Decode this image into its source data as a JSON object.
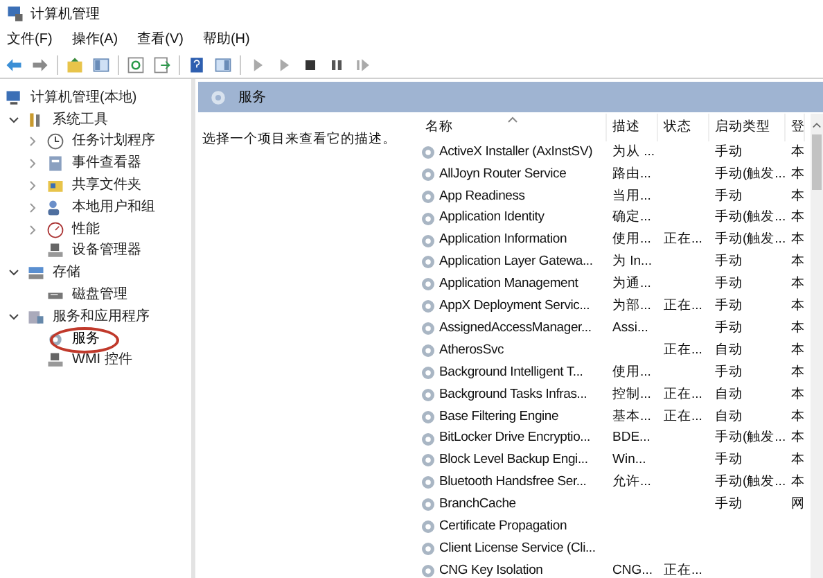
{
  "window": {
    "title": "计算机管理"
  },
  "menu": [
    "文件(F)",
    "操作(A)",
    "查看(V)",
    "帮助(H)"
  ],
  "tree": [
    {
      "label": "计算机管理(本地)",
      "kind": "computer",
      "selected": false,
      "children": [
        {
          "label": "系统工具",
          "kind": "tools",
          "expanded": true,
          "selected": false,
          "children": [
            {
              "label": "任务计划程序",
              "kind": "clock",
              "expanded": false,
              "selected": false
            },
            {
              "label": "事件查看器",
              "kind": "log",
              "expanded": false,
              "selected": false
            },
            {
              "label": "共享文件夹",
              "kind": "folder",
              "expanded": false,
              "selected": false
            },
            {
              "label": "本地用户和组",
              "kind": "users",
              "expanded": false,
              "selected": false
            },
            {
              "label": "性能",
              "kind": "gauge",
              "expanded": false,
              "selected": false
            },
            {
              "label": "设备管理器",
              "kind": "device",
              "selected": false
            }
          ]
        },
        {
          "label": "存储",
          "kind": "storage",
          "expanded": true,
          "selected": false,
          "children": [
            {
              "label": "磁盘管理",
              "kind": "disk",
              "selected": false
            }
          ]
        },
        {
          "label": "服务和应用程序",
          "kind": "apps",
          "expanded": true,
          "selected": false,
          "children": [
            {
              "label": "服务",
              "kind": "gear",
              "selected": true
            },
            {
              "label": "WMI 控件",
              "kind": "device",
              "selected": false
            }
          ]
        }
      ]
    }
  ],
  "pane": {
    "title": "服务",
    "hint": "选择一个项目来查看它的描述。"
  },
  "columns": [
    {
      "label": "名称",
      "sorted": true
    },
    {
      "label": "描述",
      "sorted": false
    },
    {
      "label": "状态",
      "sorted": false
    },
    {
      "label": "启动类型",
      "sorted": false
    },
    {
      "label": "登",
      "sorted": false
    }
  ],
  "rows": [
    {
      "name": "ActiveX Installer (AxInstSV)",
      "description": "为从 ...",
      "startup": "手动",
      "logon": "本"
    },
    {
      "name": "AllJoyn Router Service",
      "description": "路由...",
      "startup": "手动(触发...",
      "logon": "本"
    },
    {
      "name": "App Readiness",
      "description": "当用...",
      "startup": "手动",
      "logon": "本"
    },
    {
      "name": "Application Identity",
      "description": "确定...",
      "startup": "手动(触发...",
      "logon": "本"
    },
    {
      "name": "Application Information",
      "description": "使用...",
      "status": "正在...",
      "startup": "手动(触发...",
      "logon": "本"
    },
    {
      "name": "Application Layer Gatewa...",
      "description": "为 In...",
      "startup": "手动",
      "logon": "本"
    },
    {
      "name": "Application Management",
      "description": "为通...",
      "startup": "手动",
      "logon": "本"
    },
    {
      "name": "AppX Deployment Servic...",
      "description": "为部...",
      "status": "正在...",
      "startup": "手动",
      "logon": "本"
    },
    {
      "name": "AssignedAccessManager...",
      "description": "Assi...",
      "startup": "手动",
      "logon": "本"
    },
    {
      "name": "AtherosSvc",
      "status": "正在...",
      "startup": "自动",
      "logon": "本"
    },
    {
      "name": "Background Intelligent T...",
      "description": "使用...",
      "startup": "手动",
      "logon": "本"
    },
    {
      "name": "Background Tasks Infras...",
      "description": "控制...",
      "status": "正在...",
      "startup": "自动",
      "logon": "本"
    },
    {
      "name": "Base Filtering Engine",
      "description": "基本...",
      "status": "正在...",
      "startup": "自动",
      "logon": "本"
    },
    {
      "name": "BitLocker Drive Encryptio...",
      "description": "BDE...",
      "startup": "手动(触发...",
      "logon": "本"
    },
    {
      "name": "Block Level Backup Engi...",
      "description": "Win...",
      "startup": "手动",
      "logon": "本"
    },
    {
      "name": "Bluetooth Handsfree Ser...",
      "description": "允许...",
      "startup": "手动(触发...",
      "logon": "本"
    },
    {
      "name": "BranchCache",
      "startup": "手动",
      "logon": "网"
    },
    {
      "name": "Certificate Propagation"
    },
    {
      "name": "Client License Service (Cli..."
    },
    {
      "name": "CNG Key Isolation",
      "description": "CNG...",
      "status": "正在..."
    }
  ]
}
